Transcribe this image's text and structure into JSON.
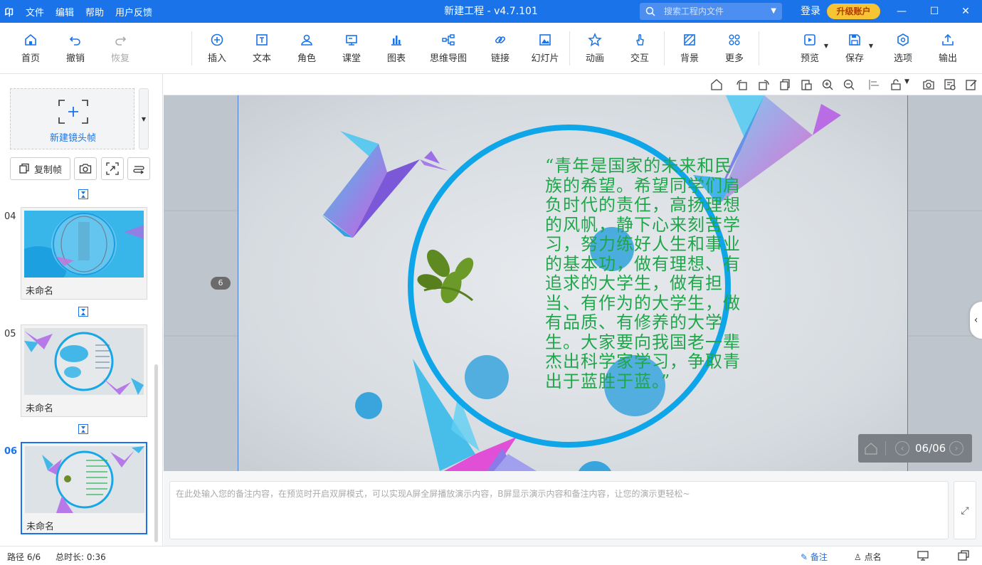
{
  "app": {
    "logo": "卬",
    "title": "新建工程 - v4.7.101"
  },
  "menu": [
    "文件",
    "编辑",
    "帮助",
    "用户反馈"
  ],
  "search": {
    "placeholder": "搜索工程内文件"
  },
  "account": {
    "login": "登录",
    "upgrade": "升级账户"
  },
  "toolbar": [
    {
      "label": "首页",
      "icon": "home-icon"
    },
    {
      "label": "撤销",
      "icon": "undo-icon"
    },
    {
      "label": "恢复",
      "icon": "redo-icon",
      "disabled": true
    },
    {
      "label": "插入",
      "icon": "insert-icon"
    },
    {
      "label": "文本",
      "icon": "text-icon"
    },
    {
      "label": "角色",
      "icon": "role-icon"
    },
    {
      "label": "课堂",
      "icon": "classroom-icon"
    },
    {
      "label": "图表",
      "icon": "chart-icon"
    },
    {
      "label": "思维导图",
      "icon": "mindmap-icon"
    },
    {
      "label": "链接",
      "icon": "link-icon"
    },
    {
      "label": "幻灯片",
      "icon": "slideshow-icon"
    },
    {
      "label": "动画",
      "icon": "animation-icon"
    },
    {
      "label": "交互",
      "icon": "interaction-icon"
    },
    {
      "label": "背景",
      "icon": "background-icon"
    },
    {
      "label": "更多",
      "icon": "more-icon"
    },
    {
      "label": "预览",
      "icon": "preview-icon"
    },
    {
      "label": "保存",
      "icon": "save-icon"
    },
    {
      "label": "选项",
      "icon": "options-icon"
    },
    {
      "label": "输出",
      "icon": "export-icon"
    }
  ],
  "sidebar": {
    "new_frame": "新建镜头帧",
    "copy_frame": "复制帧",
    "slides": [
      {
        "num": "04",
        "name": "未命名"
      },
      {
        "num": "05",
        "name": "未命名"
      },
      {
        "num": "06",
        "name": "未命名",
        "current": true
      }
    ]
  },
  "canvas": {
    "quote": "“青年是国家的未来和民族的希望。希望同学们肩负时代的责任，高扬理想的风帆，静下心来刻苦学习，努力练好人生和事业的基本功，做有理想、有追求的大学生，做有担当、有作为的大学生，做有品质、有修养的大学生。大家要向我国老一辈杰出科学家学习，争取青出于蓝胜于蓝。”",
    "page_badge": "6",
    "nav_page": "06/06"
  },
  "notes": {
    "placeholder": "在此处输入您的备注内容，在预览时开启双屏模式，可以实现A屏全屏播放演示内容，B屏显示演示内容和备注内容，让您的演示更轻松~"
  },
  "status": {
    "path": "路径 6/6",
    "duration": "总时长: 0:36",
    "notes_btn": "备注",
    "rollcall_btn": "点名"
  },
  "colors": {
    "accent": "#1a73e8",
    "quote_text": "#1fa64a",
    "ring": "#0ea5e9",
    "upgrade": "#f7c533"
  }
}
